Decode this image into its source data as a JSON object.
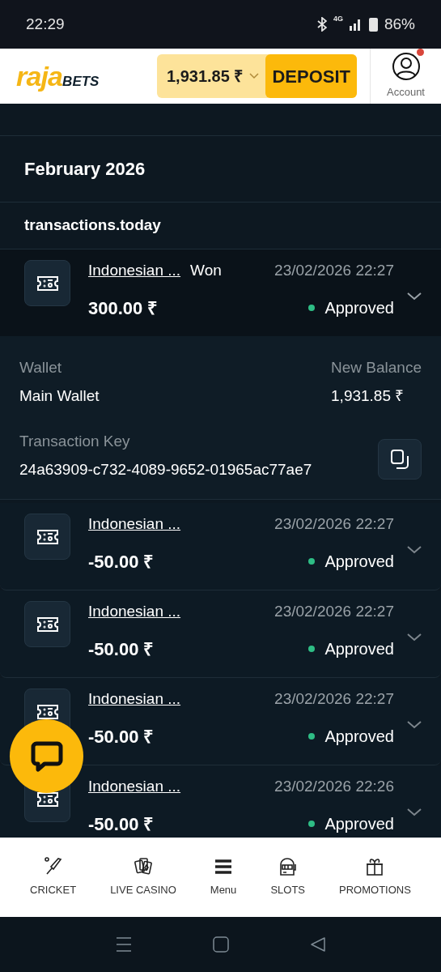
{
  "status_bar": {
    "time": "22:29",
    "network": "4G",
    "battery": "86%"
  },
  "header": {
    "logo_main": "raja",
    "logo_sub": "BETS",
    "balance": "1,931.85 ₹",
    "deposit": "DEPOSIT",
    "account": "Account",
    "account_notification": true
  },
  "month": "February 2026",
  "section": "transactions.today",
  "transactions": [
    {
      "game": "Indonesian ...",
      "type": "Won",
      "date": "23/02/2026 22:27",
      "amount": "300.00 ₹",
      "status": "Approved",
      "expanded": true,
      "details": {
        "wallet_label": "Wallet",
        "wallet": "Main Wallet",
        "balance_label": "New Balance",
        "balance": "1,931.85 ₹",
        "key_label": "Transaction Key",
        "key": "24a63909-c732-4089-9652-01965ac77ae7"
      }
    },
    {
      "game": "Indonesian ...",
      "date": "23/02/2026 22:27",
      "amount": "-50.00 ₹",
      "status": "Approved",
      "expanded": false
    },
    {
      "game": "Indonesian ...",
      "date": "23/02/2026 22:27",
      "amount": "-50.00 ₹",
      "status": "Approved",
      "expanded": false
    },
    {
      "game": "Indonesian ...",
      "date": "23/02/2026 22:27",
      "amount": "-50.00 ₹",
      "status": "Approved",
      "expanded": false
    },
    {
      "game": "Indonesian ...",
      "date": "23/02/2026 22:26",
      "amount": "-50.00 ₹",
      "status": "Approved",
      "expanded": false
    }
  ],
  "bottom_nav": [
    {
      "kind": "cricket",
      "label": "CRICKET"
    },
    {
      "kind": "cards",
      "label": "LIVE CASINO"
    },
    {
      "kind": "menu",
      "label": "Menu"
    },
    {
      "kind": "slots",
      "label": "SLOTS"
    },
    {
      "kind": "gift",
      "label": "PROMOTIONS"
    }
  ]
}
